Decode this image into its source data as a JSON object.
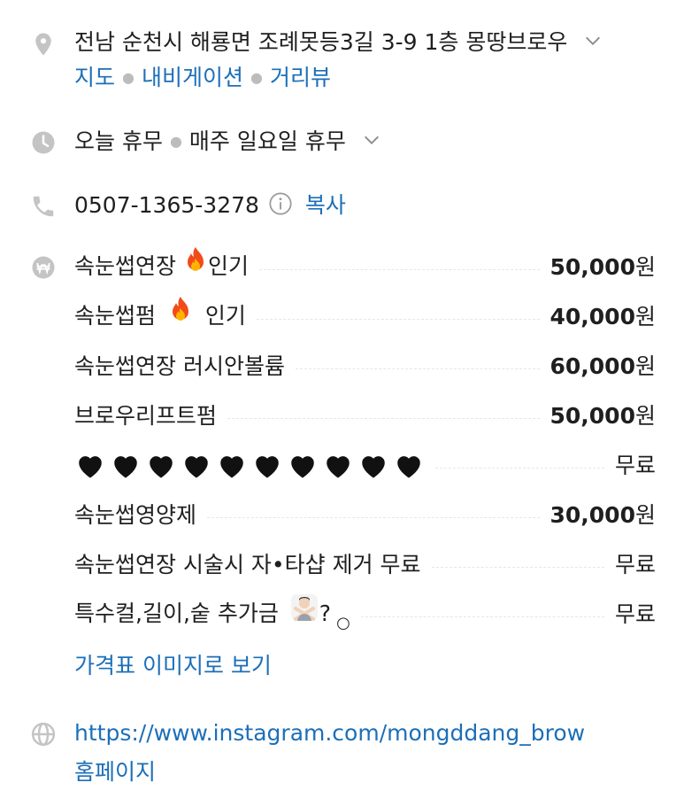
{
  "address": {
    "text": "전남 순천시 해룡면 조례못등3길 3-9 1층 몽땅브로우",
    "links": [
      "지도",
      "내비게이션",
      "거리뷰"
    ]
  },
  "hours": {
    "status": "오늘 휴무",
    "detail": "매주 일요일 휴무"
  },
  "phone": {
    "number": "0507-1365-3278",
    "copy_label": "복사"
  },
  "menu": {
    "items": [
      {
        "name": "속눈썹연장",
        "tag": "인기",
        "price_num": "50,000",
        "price_unit": "원"
      },
      {
        "name": "속눈썹펌",
        "tag": "인기",
        "price_num": "40,000",
        "price_unit": "원"
      },
      {
        "name": "속눈썹연장 러시안볼륨",
        "price_num": "60,000",
        "price_unit": "원"
      },
      {
        "name": "브로우리프트펌",
        "price_num": "50,000",
        "price_unit": "원"
      },
      {
        "name": "",
        "price_text": "무료",
        "hearts": 10
      },
      {
        "name": "속눈썹영양제",
        "price_num": "30,000",
        "price_unit": "원"
      },
      {
        "name": "속눈썹연장 시술시 자•타샵 제거 무료",
        "price_text": "무료"
      },
      {
        "name": "특수컬,길이,숱 추가금",
        "suffix": "?",
        "price_text": "무료"
      }
    ],
    "view_image_link": "가격표 이미지로 보기"
  },
  "website": {
    "url": "https://www.instagram.com/mongddang_brow",
    "label": "홈페이지"
  },
  "colors": {
    "link": "#1c6fb8",
    "icon": "#c4c4c4",
    "text": "#1f1f1f"
  }
}
